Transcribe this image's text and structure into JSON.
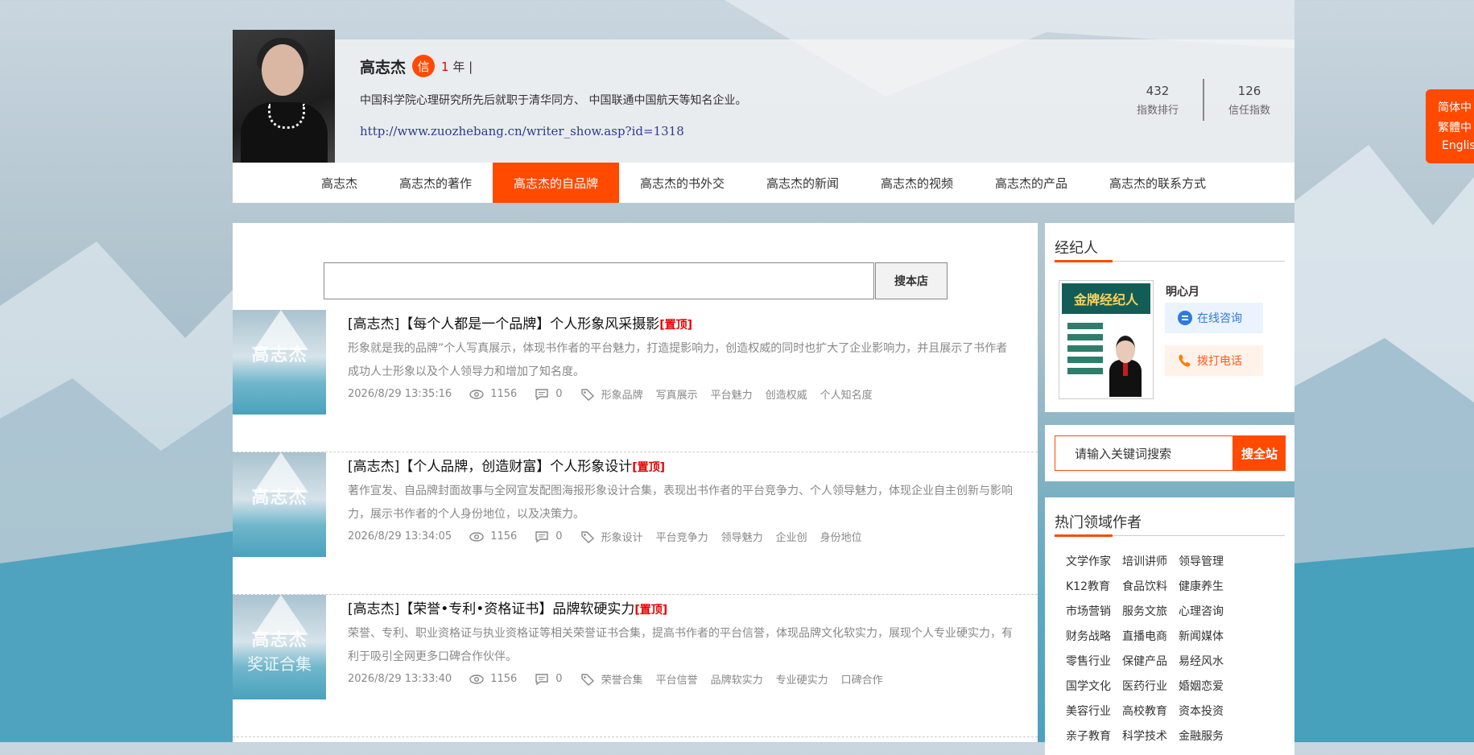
{
  "header": {
    "name": "高志杰",
    "badge": "信",
    "years_num": "1",
    "years_suffix": " 年 |",
    "bio": "中国科学院心理研究所先后就职于清华同方、 中国联通中国航天等知名企业。",
    "url": "http://www.zuozhebang.cn/writer_show.asp?id=1318",
    "stats": [
      {
        "value": "432",
        "label": "指数排行"
      },
      {
        "value": "126",
        "label": "信任指数"
      }
    ]
  },
  "nav": {
    "items": [
      "高志杰",
      "高志杰的著作",
      "高志杰的自品牌",
      "高志杰的书外交",
      "高志杰的新闻",
      "高志杰的视频",
      "高志杰的产品",
      "高志杰的联系方式"
    ],
    "active_index": 2
  },
  "shop_search": {
    "value": "",
    "button": "搜本店"
  },
  "articles": [
    {
      "title": "[高志杰]【每个人都是一个品牌】个人形象风采摄影",
      "pin": "[置顶]",
      "desc": "形象就是我的品牌”个人写真展示，体现书作者的平台魅力，打造提影响力，创造权威的同时也扩大了企业影响力，并且展示了书作者成功人士形象以及个人领导力和增加了知名度。",
      "date": "2026/8/29 13:35:16",
      "views": "1156",
      "comments": "0",
      "tags": [
        "形象品牌",
        "写真展示",
        "平台魅力",
        "创造权威",
        "个人知名度"
      ],
      "thumb_title": "高志杰",
      "thumb_sub": ""
    },
    {
      "title": "[高志杰]【个人品牌，创造财富】个人形象设计",
      "pin": "[置顶]",
      "desc": "著作宣发、自品牌封面故事与全网宣发配图海报形象设计合集，表现出书作者的平台竞争力、个人领导魅力，体现企业自主创新与影响力，展示书作者的个人身份地位，以及决策力。",
      "date": "2026/8/29 13:34:05",
      "views": "1156",
      "comments": "0",
      "tags": [
        "形象设计",
        "平台竞争力",
        "领导魅力",
        "企业创",
        "身份地位"
      ],
      "thumb_title": "高志杰",
      "thumb_sub": ""
    },
    {
      "title": "[高志杰]【荣誉•专利•资格证书】品牌软硬实力",
      "pin": "[置顶]",
      "desc": "荣誉、专利、职业资格证与执业资格证等相关荣誉证书合集，提高书作者的平台信誉，体现品牌文化软实力，展现个人专业硬实力，有利于吸引全网更多口碑合作伙伴。",
      "date": "2026/8/29 13:33:40",
      "views": "1156",
      "comments": "0",
      "tags": [
        "荣誉合集",
        "平台信誉",
        "品牌软实力",
        "专业硬实力",
        "口碑合作"
      ],
      "thumb_title": "高志杰",
      "thumb_sub": "奖证合集"
    }
  ],
  "agent_card": {
    "title": "经纪人",
    "image_title": "金牌经纪人",
    "agent_name": "明心月",
    "chat_label": "在线咨询",
    "call_label": "拨打电话"
  },
  "site_search": {
    "placeholder": "请输入关键词搜索",
    "button": "搜全站"
  },
  "hot_authors": {
    "title": "热门领域作者",
    "tags": [
      "文学作家",
      "培训讲师",
      "领导管理",
      "K12教育",
      "食品饮料",
      "健康养生",
      "市场营销",
      "服务文旅",
      "心理咨询",
      "财务战略",
      "直播电商",
      "新闻媒体",
      "零售行业",
      "保健产品",
      "易经风水",
      "国学文化",
      "医药行业",
      "婚姻恋爱",
      "美容行业",
      "高校教育",
      "资本投资",
      "亲子教育",
      "科学技术",
      "金融服务"
    ]
  },
  "language": {
    "simplified": "简体中",
    "traditional": "繁體中",
    "english": "Englis"
  },
  "colors": {
    "accent": "#ff4a00",
    "pin": "#e60000",
    "link": "#2a3c8c"
  }
}
